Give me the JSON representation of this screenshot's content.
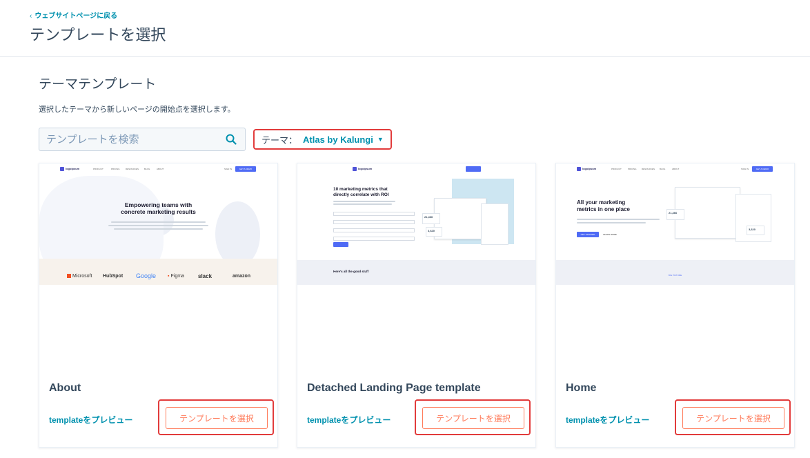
{
  "header": {
    "back_label": "ウェブサイトページに戻る",
    "title": "テンプレートを選択"
  },
  "section": {
    "title": "テーマテンプレート",
    "description": "選択したテーマから新しいページの開始点を選択します。"
  },
  "search": {
    "placeholder": "テンプレートを検索"
  },
  "theme_filter": {
    "label": "テーマ：",
    "value": "Atlas by Kalungi"
  },
  "cards": [
    {
      "name": "About",
      "preview_label": "templateをプレビュー",
      "select_label": "テンプレートを選択",
      "thumb": {
        "logo": "logoipsum",
        "nav": [
          "PRODUCT",
          "PRICING",
          "RESOURCES",
          "BLOG",
          "ABOUT",
          "SIGN IN"
        ],
        "cta": "GET A DEMO",
        "heading_line1": "Empowering teams with",
        "heading_line2": "concrete marketing results",
        "brands": [
          "Microsoft",
          "HubSpot",
          "Google",
          "Figma",
          "slack",
          "amazon"
        ]
      }
    },
    {
      "name": "Detached Landing Page template",
      "preview_label": "templateをプレビュー",
      "select_label": "テンプレートを選択",
      "thumb": {
        "logo": "logoipsum",
        "heading_line1": "10 marketing metrics that",
        "heading_line2": "directly correlate with ROI",
        "section_heading": "Here's all the good stuff",
        "stat1": "21,466",
        "stat2": "3,620"
      }
    },
    {
      "name": "Home",
      "preview_label": "templateをプレビュー",
      "select_label": "テンプレートを選択",
      "thumb": {
        "logo": "logoipsum",
        "nav": [
          "PRODUCT",
          "PRICING",
          "RESOURCES",
          "BLOG",
          "ABOUT",
          "SIGN IN"
        ],
        "cta": "GET A DEMO",
        "heading_line1": "All your marketing",
        "heading_line2": "metrics in one place",
        "cta2": "GET STARTED",
        "cta3": "LEARN MORE",
        "stat1": "21,466",
        "stat2": "3,620",
        "footer_label": "BIG PICTURE"
      }
    }
  ],
  "colors": {
    "accent_link": "#0091ae",
    "primary_orange": "#ff7a59",
    "highlight_red": "#e23b3b",
    "text_dark": "#33475b"
  },
  "icons": {
    "search": "search-icon",
    "back": "chevron-left-icon",
    "caret": "caret-down-icon"
  }
}
